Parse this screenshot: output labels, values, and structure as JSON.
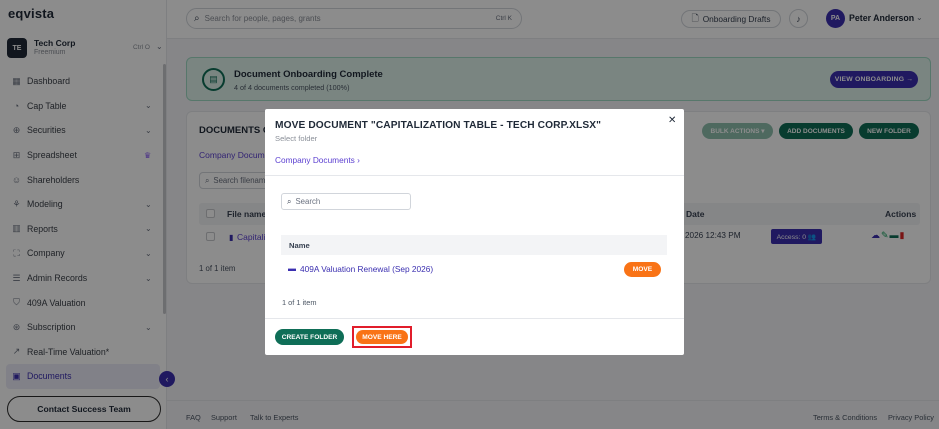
{
  "app": {
    "logo": "eqvista"
  },
  "org": {
    "initials": "TE",
    "name": "Tech Corp",
    "plan": "Freemium",
    "shortcut": "Ctrl O"
  },
  "nav": [
    {
      "label": "Dashboard",
      "icon": "dashboard-icon",
      "chevron": false
    },
    {
      "label": "Cap Table",
      "icon": "cap-table-icon",
      "chevron": true
    },
    {
      "label": "Securities",
      "icon": "securities-icon",
      "chevron": true
    },
    {
      "label": "Spreadsheet",
      "icon": "spreadsheet-icon",
      "chevron": false,
      "crown": true
    },
    {
      "label": "Shareholders",
      "icon": "shareholders-icon",
      "chevron": false
    },
    {
      "label": "Modeling",
      "icon": "modeling-icon",
      "chevron": true
    },
    {
      "label": "Reports",
      "icon": "reports-icon",
      "chevron": true
    },
    {
      "label": "Company",
      "icon": "company-icon",
      "chevron": true
    },
    {
      "label": "Admin Records",
      "icon": "admin-records-icon",
      "chevron": true
    },
    {
      "label": "409A Valuation",
      "icon": "valuation-icon",
      "chevron": false
    },
    {
      "label": "Subscription",
      "icon": "subscription-icon",
      "chevron": true
    },
    {
      "label": "Real-Time Valuation*",
      "icon": "realtime-valuation-icon",
      "chevron": false
    },
    {
      "label": "Documents",
      "icon": "documents-icon",
      "chevron": false,
      "active": true
    }
  ],
  "sidebar": {
    "contact_label": "Contact Success Team"
  },
  "topbar": {
    "search_placeholder": "Search for people, pages, grants",
    "search_shortcut": "Ctrl K",
    "onboarding_label": "Onboarding Drafts",
    "user_initials": "PA",
    "user_name": "Peter Anderson"
  },
  "banner": {
    "title": "Document Onboarding Complete",
    "subtitle": "4 of 4 documents completed (100%)",
    "button": "VIEW ONBOARDING →"
  },
  "docs": {
    "title": "DOCUMENTS OV",
    "bulk_actions": "BULK ACTIONS ▾",
    "add_documents": "ADD DOCUMENTS",
    "new_folder": "NEW FOLDER",
    "breadcrumb": "Company Docume",
    "search_placeholder": "Search filenam",
    "col_file": "File name",
    "col_date": "Date",
    "col_actions": "Actions",
    "row_file": "Capitali",
    "row_date": "2026 12:43 PM",
    "access_label": "Access: 0 👥",
    "count": "1 of 1 item"
  },
  "footer": {
    "faq": "FAQ",
    "support": "Support",
    "talk": "Talk to Experts",
    "terms": "Terms & Conditions",
    "privacy": "Privacy Policy"
  },
  "modal": {
    "title": "MOVE DOCUMENT \"CAPITALIZATION TABLE - TECH CORP.XLSX\"",
    "subtitle": "Select folder",
    "breadcrumb": "Company Documents  ›",
    "search_placeholder": "Search",
    "col_name": "Name",
    "folders": [
      {
        "name": "409A Valuation Renewal (Sep 2026)",
        "move_label": "MOVE"
      }
    ],
    "count": "1 of 1 item",
    "create_folder": "CREATE FOLDER",
    "move_here": "MOVE HERE"
  },
  "colors": {
    "brand_purple": "#3b2fb0",
    "brand_green": "#0f6e57",
    "accent_orange": "#f97316",
    "highlight_red": "#e11d2b"
  }
}
